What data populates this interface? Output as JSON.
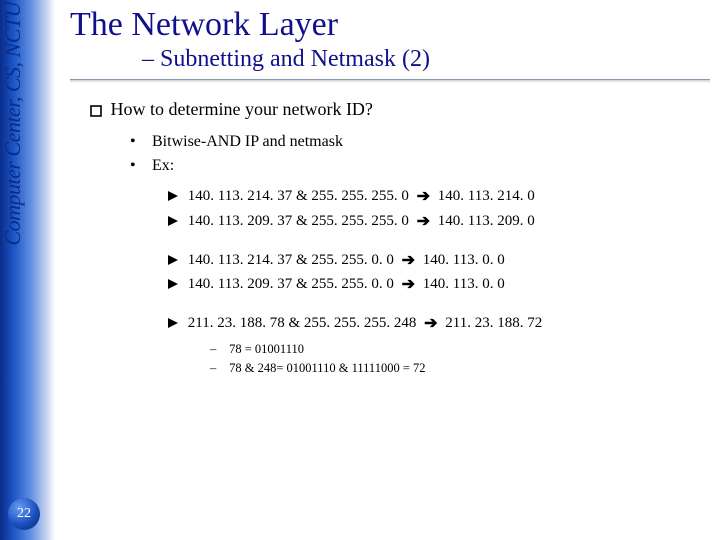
{
  "rail": {
    "label": "Computer Center, CS, NCTU",
    "page_number": "22"
  },
  "heading": {
    "title": "The Network Layer",
    "subtitle": "– Subnetting and Netmask (2)"
  },
  "question": "How to determine your network ID?",
  "sub_bullets": [
    "Bitwise-AND IP and netmask",
    "Ex:"
  ],
  "ex_group1": [
    {
      "lhs": "140. 113. 214. 37 & 255. 255. 255. 0",
      "rhs": "140. 113. 214. 0"
    },
    {
      "lhs": "140. 113. 209. 37 & 255. 255. 255. 0",
      "rhs": "140. 113. 209. 0"
    }
  ],
  "ex_group2": [
    {
      "lhs": "140. 113. 214. 37 & 255. 255. 0. 0",
      "rhs": "140. 113. 0. 0"
    },
    {
      "lhs": "140. 113. 209. 37 & 255. 255. 0. 0",
      "rhs": "140. 113. 0. 0"
    }
  ],
  "ex_group3": [
    {
      "lhs": "211. 23. 188. 78 & 255. 255. 255. 248",
      "rhs": "211. 23. 188. 72"
    }
  ],
  "detail_lines": [
    "78 = 01001110",
    "78 & 248= 01001110 & 11111000 = 72"
  ],
  "glyphs": {
    "dot": "•",
    "dash": "–",
    "arrow": "➔"
  }
}
